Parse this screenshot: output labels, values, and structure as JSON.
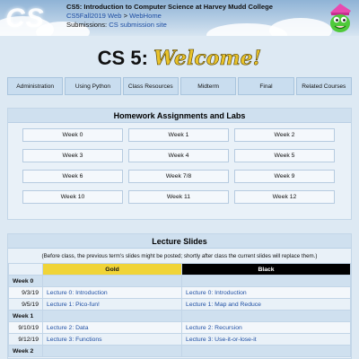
{
  "header": {
    "logo_text": "CS",
    "course_title": "CS5: Introduction to Computer Science at Harvey Mudd College",
    "breadcrumb_web": "CS5Fall2019 Web",
    "breadcrumb_sep": " > ",
    "breadcrumb_home": "WebHome",
    "submissions_label": "Submissions: ",
    "submissions_link": "CS submission site"
  },
  "title": {
    "prefix": "CS 5:",
    "welcome": "Welcome!"
  },
  "nav": [
    "Administration",
    "Using Python",
    "Class Resources",
    "Midterm",
    "Final",
    "Related Courses"
  ],
  "homework": {
    "heading": "Homework Assignments and Labs",
    "weeks": [
      "Week 0",
      "Week 1",
      "Week 2",
      "Week 3",
      "Week 4",
      "Week 5",
      "Week 6",
      "Week 7/8",
      "Week 9",
      "Week 10",
      "Week 11",
      "Week 12"
    ]
  },
  "slides": {
    "heading": "Lecture Slides",
    "note": "(Before class, the previous term's slides might be posted; shortly after class the current slides will replace them.)",
    "col_gold": "Gold",
    "col_black": "Black",
    "rows": [
      {
        "type": "week",
        "label": "Week 0"
      },
      {
        "type": "lecture",
        "date": "9/3/19",
        "gold": "Lecture 0: Introduction",
        "black": "Lecture 0: Introduction"
      },
      {
        "type": "lecture",
        "date": "9/5/19",
        "gold": "Lecture 1: Pico-fun!",
        "black": "Lecture 1: Map and Reduce"
      },
      {
        "type": "week",
        "label": "Week 1"
      },
      {
        "type": "lecture",
        "date": "9/10/19",
        "gold": "Lecture 2: Data",
        "black": "Lecture 2: Recursion"
      },
      {
        "type": "lecture",
        "date": "9/12/19",
        "gold": "Lecture 3: Functions",
        "black": "Lecture 3: Use-it-or-lose-it"
      },
      {
        "type": "week",
        "label": "Week 2"
      }
    ]
  },
  "colors": {
    "gold": "#f0d437",
    "black": "#000000",
    "link": "#1f4fa3",
    "panel": "#cfe0ef"
  }
}
